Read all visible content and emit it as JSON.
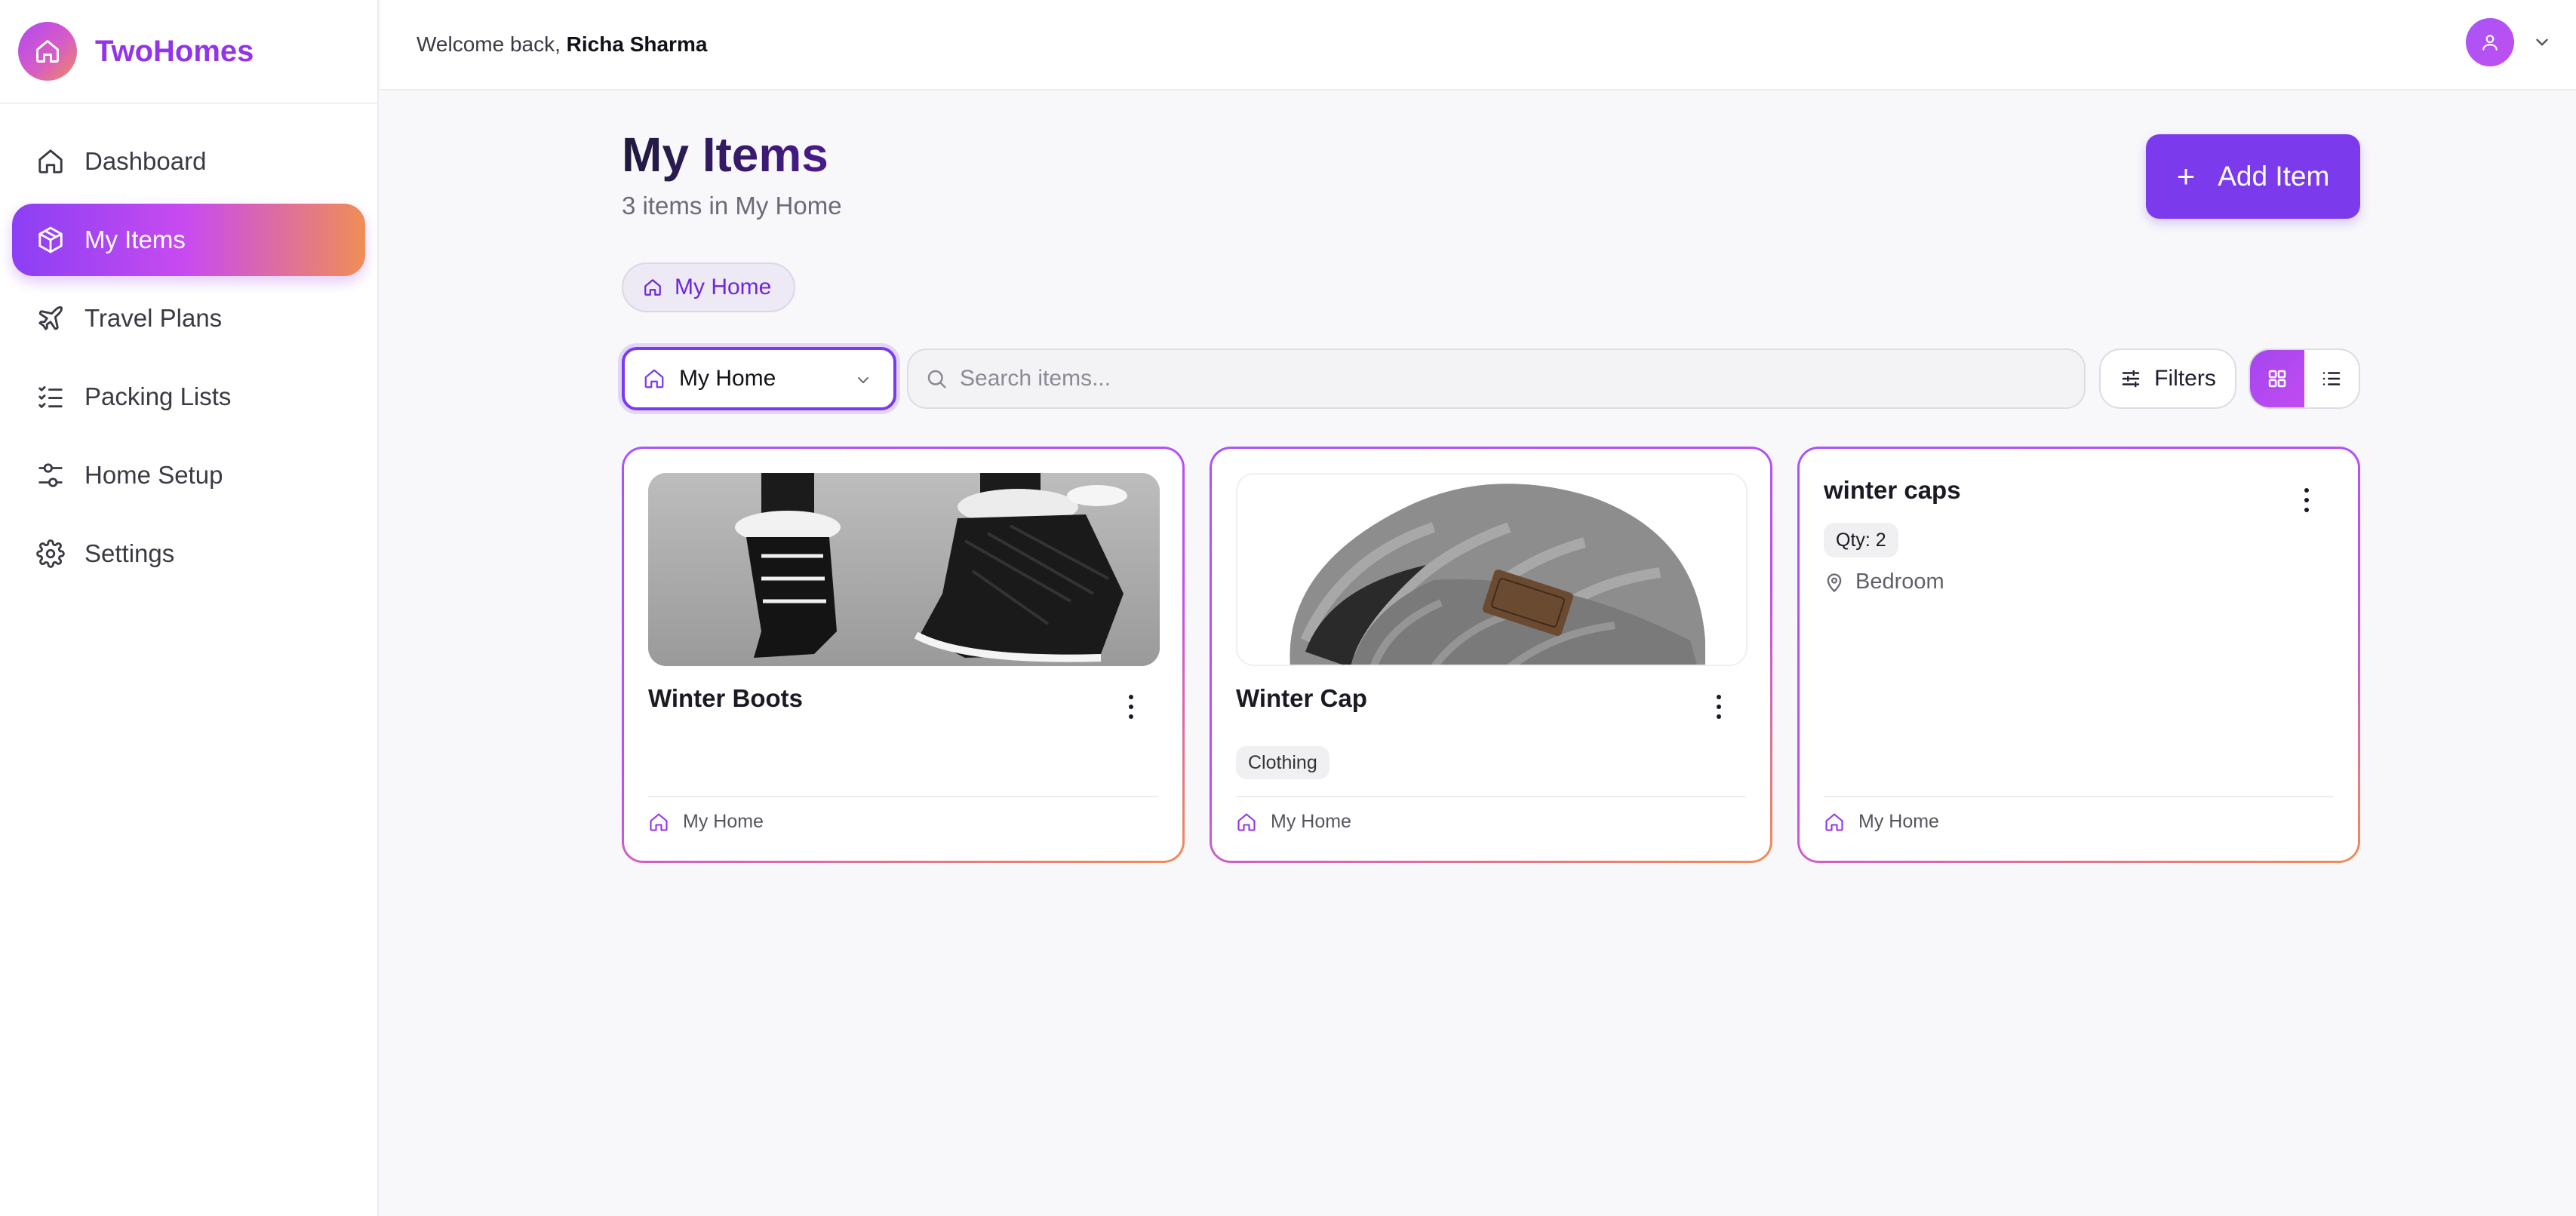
{
  "app": {
    "name": "TwoHomes"
  },
  "header": {
    "welcome_prefix": "Welcome back,",
    "user_name": "Richa Sharma"
  },
  "sidebar": {
    "items": [
      {
        "label": "Dashboard",
        "icon": "home-icon",
        "active": false
      },
      {
        "label": "My Items",
        "icon": "box-icon",
        "active": true
      },
      {
        "label": "Travel Plans",
        "icon": "plane-icon",
        "active": false
      },
      {
        "label": "Packing Lists",
        "icon": "checklist-icon",
        "active": false
      },
      {
        "label": "Home Setup",
        "icon": "sliders-icon",
        "active": false
      },
      {
        "label": "Settings",
        "icon": "gear-icon",
        "active": false
      }
    ]
  },
  "main": {
    "title": "My Items",
    "subtitle": "3 items in My Home",
    "add_button_label": "Add Item",
    "home_chip": "My Home",
    "home_select_value": "My Home",
    "search_placeholder": "Search items...",
    "filters_label": "Filters",
    "view_mode": "grid"
  },
  "cards": [
    {
      "title": "Winter Boots",
      "image": "winter-boots-photo",
      "tag": "",
      "home": "My Home"
    },
    {
      "title": "Winter Cap",
      "image": "winter-cap-photo",
      "tag": "Clothing",
      "home": "My Home"
    },
    {
      "title": "winter caps",
      "quantity": "Qty: 2",
      "location": "Bedroom",
      "home": "My Home"
    }
  ],
  "colors": {
    "brand": "#9333ea",
    "accent": "#7c3aed",
    "gradient_start": "#8b3ff5",
    "gradient_end": "#f08e55"
  }
}
